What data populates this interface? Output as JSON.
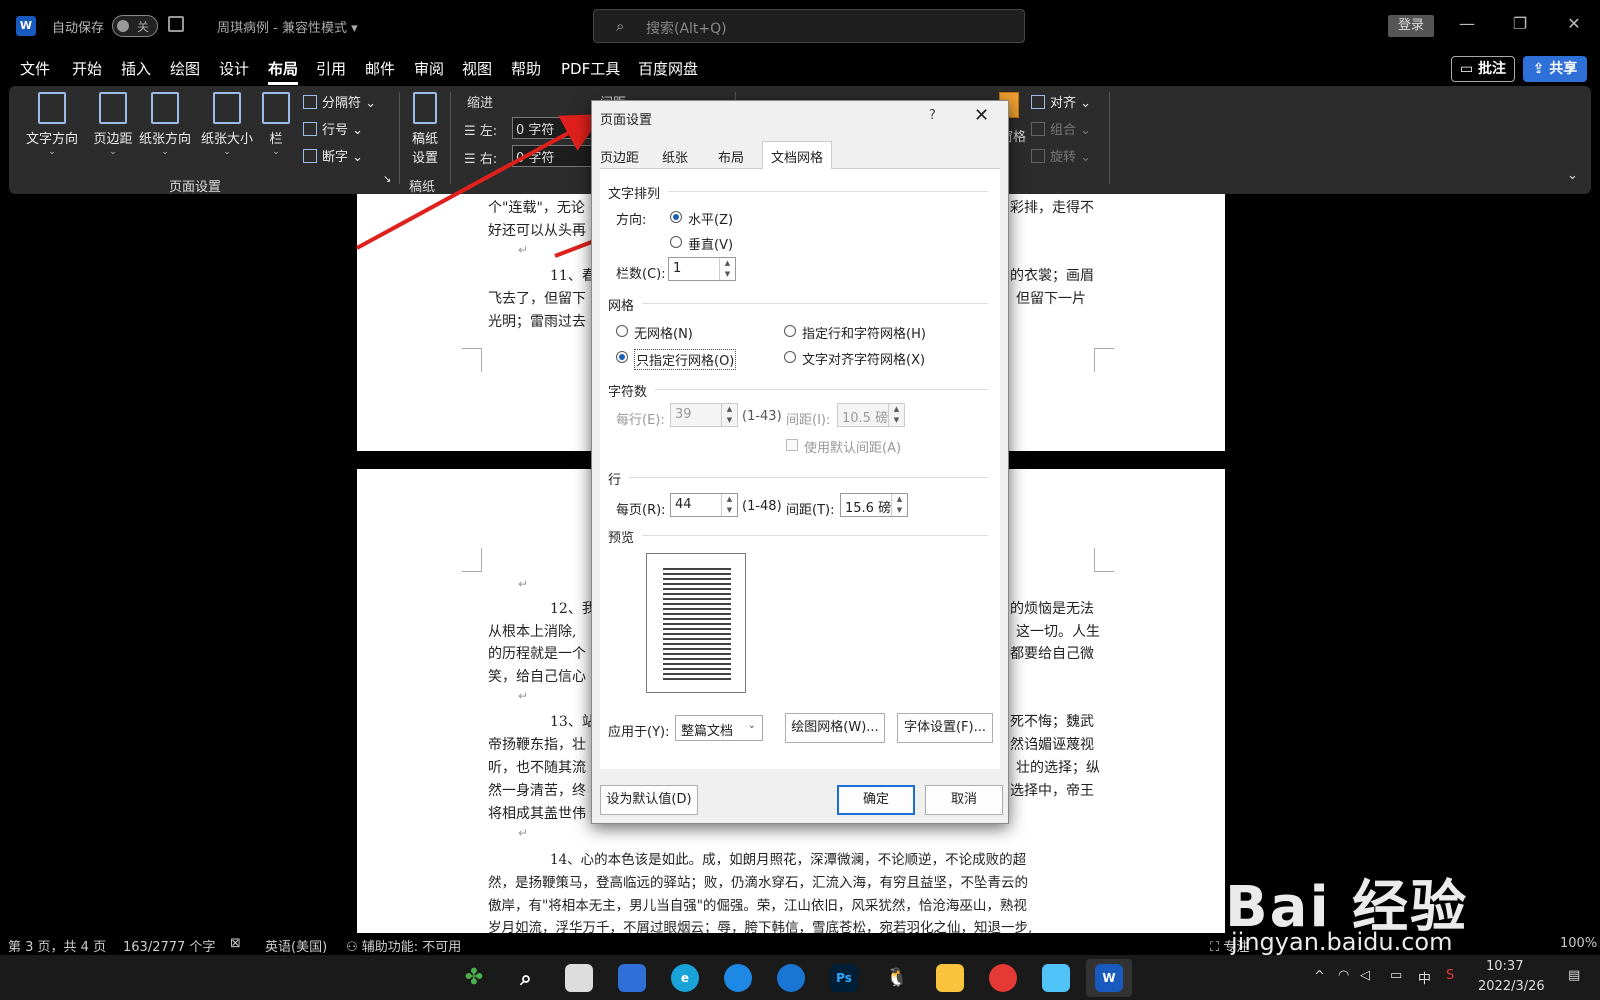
{
  "titlebar": {
    "app_icon": "W",
    "autosave_label": "自动保存",
    "autosave_state": "关",
    "doc_title": "周琪病例 - 兼容性模式 ▾",
    "search_placeholder": "搜索(Alt+Q)",
    "login": "登录"
  },
  "menu": {
    "items": [
      "文件",
      "开始",
      "插入",
      "绘图",
      "设计",
      "布局",
      "引用",
      "邮件",
      "审阅",
      "视图",
      "帮助",
      "PDF工具",
      "百度网盘"
    ],
    "active": "布局",
    "comment": "批注",
    "share": "共享"
  },
  "ribbon": {
    "text_direction": "文字方向",
    "margins": "页边距",
    "orientation": "纸张方向",
    "size": "纸张大小",
    "columns": "栏",
    "breaks": "分隔符",
    "line_numbers": "行号",
    "hyphenation": "断字",
    "page_setup_group": "页面设置",
    "draft_paper": "稿纸设置",
    "draft_group": "稿纸",
    "indent_title": "缩进",
    "spacing_title": "间距",
    "indent_left_label": "左:",
    "indent_left_value": "0 字符",
    "indent_right_label": "右:",
    "indent_right_value": "0 字符",
    "align": "对齐",
    "group": "组合",
    "rotate": "旋转",
    "selection_pane": "择窗格"
  },
  "document": {
    "page1_lines": [
      "个\"连载\"，无论",
      "好还可以从头再",
      "11、春",
      "飞去了，但留下",
      "光明；雷雨过去"
    ],
    "page1_right": [
      "彩排，走得不",
      "的衣裳；画眉",
      "但留下一片"
    ],
    "page2_lines": [
      "12、我",
      "从根本上消除,",
      "的历程就是一个",
      "笑，给自己信心",
      "13、站",
      "帝扬鞭东指，壮",
      "听，也不随其流",
      "然一身清苦，终",
      "将相成其盖世伟"
    ],
    "page2_right": [
      "的烦恼是无法",
      "这一切。人生",
      "都要给自己微",
      "死不悔；魏武",
      "然诌媚诬蔑视",
      "壮的选择；纵",
      "选择中，帝王"
    ],
    "para14": [
      "14、心的本色该是如此。成，如朗月照花，深潭微澜，不论顺逆，不论成败的超",
      "然，是扬鞭策马，登高临远的驿站；败，仍滴水穿石，汇流入海，有穷且益坚，不坠青云的",
      "傲岸，有\"将相本无主，男儿当自强\"的倔强。荣，江山依旧，风采犹然，恰沧海巫山，熟视",
      "岁月如流，浮华万千，不屑过眼烟云；辱，胯下韩信，雪底苍松，宛若羽化之仙，知退一步,"
    ]
  },
  "dialog": {
    "title": "页面设置",
    "help": "?",
    "close": "✕",
    "tabs": [
      "页边距",
      "纸张",
      "布局",
      "文档网格"
    ],
    "active_tab": "文档网格",
    "text_flow_title": "文字排列",
    "direction_label": "方向:",
    "horizontal": "水平(Z)",
    "vertical": "垂直(V)",
    "columns_label": "栏数(C):",
    "columns_value": "1",
    "grid_title": "网格",
    "grid_none": "无网格(N)",
    "grid_lines_chars": "指定行和字符网格(H)",
    "grid_lines_only": "只指定行网格(O)",
    "grid_snap_chars": "文字对齐字符网格(X)",
    "chars_title": "字符数",
    "per_line_label": "每行(E):",
    "per_line_value": "39",
    "per_line_range": "(1-43)",
    "pitch_label": "间距(I):",
    "pitch_value": "10.5 磅",
    "use_default_pitch": "使用默认间距(A)",
    "lines_title": "行",
    "per_page_label": "每页(R):",
    "per_page_value": "44",
    "per_page_range": "(1-48)",
    "line_pitch_label": "间距(T):",
    "line_pitch_value": "15.6 磅",
    "preview_title": "预览",
    "apply_to_label": "应用于(Y):",
    "apply_to_value": "整篇文档",
    "drawing_grid": "绘图网格(W)...",
    "font_settings": "字体设置(F)...",
    "set_default": "设为默认值(D)",
    "ok": "确定",
    "cancel": "取消"
  },
  "statusbar": {
    "page": "第 3 页，共 4 页",
    "words": "163/2777 个字",
    "language": "英语(美国)",
    "accessibility": "辅助功能: 不可用",
    "focus": "专注",
    "zoom": "100%"
  },
  "taskbar": {
    "time": "10:37",
    "date": "2022/3/26",
    "ime": "中"
  },
  "watermark": {
    "brand": "Bai  经验",
    "url": "jingyan.baidu.com"
  },
  "colors": {
    "accent": "#2e6fd8",
    "arrow": "#e0201c",
    "ribbon_bg": "#2c2c2c"
  }
}
